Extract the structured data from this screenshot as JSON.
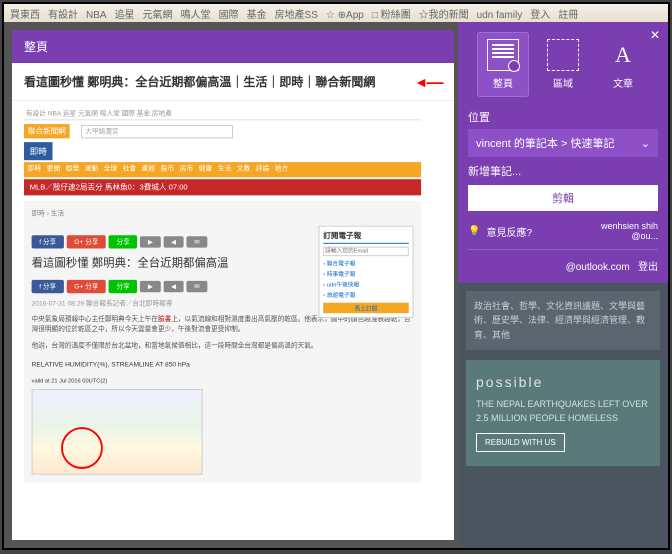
{
  "menubar": [
    "買東西",
    "有設計",
    "NBA",
    "追星",
    "元氣網",
    "鳴人堂",
    "國際",
    "基金",
    "房地產SS",
    "☆ ⊕App",
    "□ 粉絲團",
    "☆我的新聞",
    "udn family",
    "登入",
    "註冊"
  ],
  "panel": {
    "header": "整頁"
  },
  "article": {
    "title": "看這圖秒懂 鄭明典：全台近期都偏高溫｜生活｜即時｜聯合新聞網"
  },
  "preview": {
    "logo1": "聯合新聞網",
    "logo2": "即時",
    "search_ph": "大甲鎮瀾宮",
    "tabs": [
      "即時",
      "要聞",
      "娛樂",
      "運動",
      "全球",
      "社會",
      "產經",
      "股市",
      "房市",
      "健康",
      "生活",
      "文教",
      "評論",
      "地方"
    ],
    "redbar": "MLB／殷仔連2局丟分 馬林魚0：3費城人 07:00",
    "breadcrumb": "即時 › 生活",
    "headline": "看這圖秒懂 鄭明典：全台近期都偏高溫",
    "date": "2016-07-31 08:29 聯合報系記者／台北即時報導",
    "body1_a": "中央氣象局預報中心主任鄭明典今天上午在",
    "body1_link": "臉書",
    "body1_b": "上，以氣流線和相對濕度畫出高氣壓的乾區。他表示，圖中的顏色越淺表越乾，台灣很明顯的位於乾區之中，所以今天雲量會更少，午後對流會更受抑制。",
    "body2": "他說，台灣的溫度不僅限於台北盆地，和當地氣候值相比，這一段時間全台灣都是偏高溫的天氣。",
    "chart_title": "RELATIVE HUMIDITY(%), STREAMLINE AT 850 hPa",
    "chart_sub": "valid at 21 Jul 2016 00UTC(2)",
    "sidebox_title": "訂閱電子報",
    "sidebox_ph": "請輸入您的Email",
    "sideitems": [
      "聯合電子報",
      "時事電子報",
      "udn午後快報",
      "旅遊電子報"
    ],
    "sidebtn": "馬上訂閱"
  },
  "clip": {
    "modes": {
      "full": "整頁",
      "region": "區域",
      "article": "文章"
    },
    "location_label": "位置",
    "location_value": "vincent 的筆記本 > 快速筆記",
    "newnote_label": "新增筆記...",
    "copy_btn": "剪輯",
    "feedback": "意見反應?",
    "username": "wenhsien shih",
    "useremail": "@ou...",
    "account": "@outlook.com",
    "signout": "登出"
  },
  "bg": {
    "tags": "政治社會、哲學、文化資訊議題、文學與藝術、歷史學、法律、經濟學與經濟管理、教育、其他",
    "ad_brand": "possible",
    "ad_msg": "THE NEPAL EARTHQUAKES LEFT OVER 2.5 MILLION PEOPLE HOMELESS",
    "ad_btn": "REBUILD WITH US"
  }
}
